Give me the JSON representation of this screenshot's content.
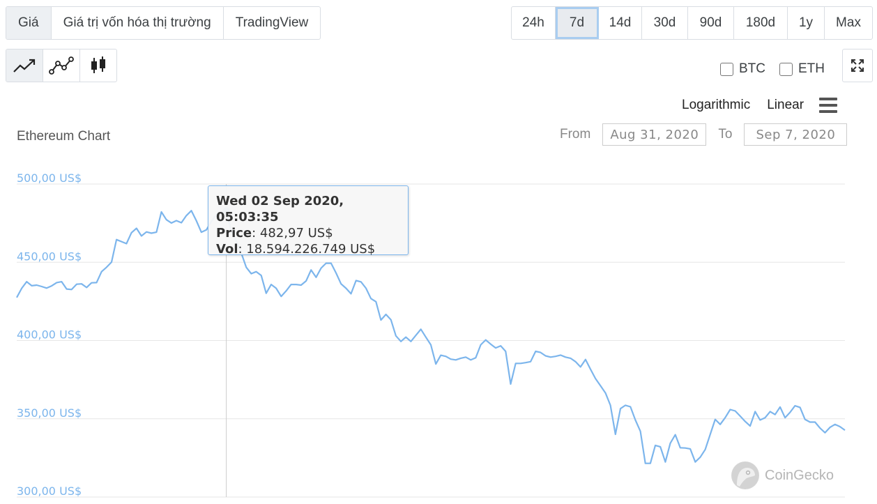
{
  "tabs": [
    {
      "label": "Giá",
      "active": true
    },
    {
      "label": "Giá trị vốn hóa thị trường",
      "active": false
    },
    {
      "label": "TradingView",
      "active": false
    }
  ],
  "ranges": [
    {
      "label": "24h",
      "active": false
    },
    {
      "label": "7d",
      "active": true
    },
    {
      "label": "14d",
      "active": false
    },
    {
      "label": "30d",
      "active": false
    },
    {
      "label": "90d",
      "active": false
    },
    {
      "label": "180d",
      "active": false
    },
    {
      "label": "1y",
      "active": false
    },
    {
      "label": "Max",
      "active": false
    }
  ],
  "chart_types": [
    {
      "icon": "line-chart-icon",
      "active": true
    },
    {
      "icon": "point-line-chart-icon",
      "active": false
    },
    {
      "icon": "candlestick-icon",
      "active": false
    }
  ],
  "compare": {
    "btc_label": "BTC",
    "eth_label": "ETH",
    "btc_checked": false,
    "eth_checked": false
  },
  "expand_icon": "expand-icon",
  "scales": {
    "log_label": "Logarithmic",
    "linear_label": "Linear",
    "menu_icon": "hamburger-menu-icon"
  },
  "title": "Ethereum Chart",
  "date_range": {
    "from_label": "From",
    "from_value": "Aug 31, 2020",
    "to_label": "To",
    "to_value": "Sep 7, 2020"
  },
  "tooltip": {
    "date": "Wed 02 Sep 2020, 05:03:35",
    "price_label": "Price",
    "price_value": ": 482,97 US$",
    "vol_label": "Vol",
    "vol_value": ": 18.594.226.749 US$"
  },
  "watermark": "CoinGecko",
  "colors": {
    "line": "#7cb5ec",
    "grid": "#e6e6e6",
    "axis_label": "#7cb5ec"
  },
  "chart_data": {
    "type": "line",
    "title": "Ethereum Chart",
    "ylim": [
      300,
      500
    ],
    "yticks": [
      500,
      450,
      400,
      350,
      300
    ],
    "ytick_labels": [
      "500,00 US$",
      "450,00 US$",
      "400,00 US$",
      "350,00 US$",
      "300,00 US$"
    ],
    "x_range": [
      "Aug 31, 2020",
      "Sep 7, 2020"
    ],
    "grid": true,
    "highlight_index": 42,
    "series": [
      {
        "values": [
          427.5,
          433.4,
          437.6,
          435.0,
          435.4,
          434.5,
          433.5,
          434.9,
          437.0,
          437.6,
          432.9,
          432.6,
          436.0,
          436.2,
          433.9,
          436.9,
          437.0,
          444.0,
          446.8,
          450.1,
          464.5,
          463.2,
          461.9,
          468.9,
          471.7,
          466.8,
          469.4,
          468.6,
          469.2,
          482.2,
          477.2,
          475.1,
          476.6,
          475.3,
          479.8,
          483.0,
          476.6,
          469.2,
          470.7,
          476.1,
          480.5,
          481.9,
          482.97,
          470.0,
          463.5,
          456.0,
          446.8,
          442.7,
          444.0,
          441.6,
          430.2,
          435.8,
          433.4,
          428.2,
          431.7,
          435.8,
          435.8,
          435.4,
          438.1,
          445.1,
          440.4,
          446.3,
          449.4,
          449.4,
          443.2,
          436.2,
          433.4,
          429.9,
          438.3,
          437.5,
          433.4,
          426.8,
          424.8,
          413.1,
          416.7,
          413.3,
          403.0,
          399.4,
          402.2,
          399.4,
          403.3,
          407.2,
          402.2,
          397.3,
          385.0,
          390.6,
          389.9,
          388.1,
          387.6,
          388.7,
          389.4,
          387.6,
          389.0,
          397.3,
          400.4,
          397.7,
          395.3,
          396.6,
          393.1,
          372.2,
          385.4,
          385.4,
          385.9,
          386.5,
          393.1,
          392.4,
          390.2,
          389.4,
          389.9,
          390.7,
          389.4,
          388.7,
          386.5,
          383.1,
          387.9,
          381.7,
          375.7,
          371.2,
          366.5,
          358.6,
          340.1,
          356.5,
          358.6,
          357.7,
          349.2,
          342.0,
          321.5,
          321.5,
          333.0,
          332.1,
          322.4,
          334.4,
          339.8,
          331.5,
          331.3,
          330.8,
          322.4,
          325.5,
          330.4,
          340.1,
          349.6,
          346.4,
          350.7,
          355.9,
          355.0,
          351.7,
          348.3,
          345.4,
          354.6,
          349.2,
          350.7,
          354.6,
          352.7,
          357.5,
          350.7,
          354.1,
          358.3,
          357.3,
          349.6,
          347.9,
          347.9,
          344.1,
          341.1,
          344.5,
          346.4,
          345.0,
          342.7
        ]
      }
    ]
  }
}
